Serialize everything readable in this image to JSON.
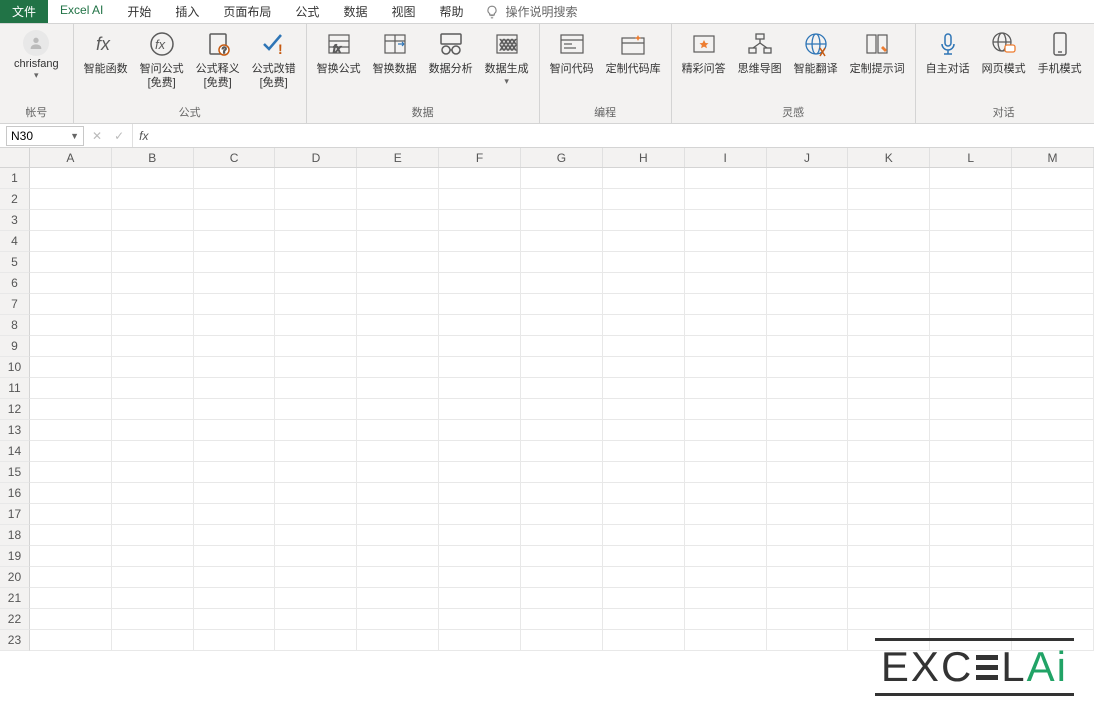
{
  "tabs": {
    "file": "文件",
    "excel_ai": "Excel AI",
    "start": "开始",
    "insert": "插入",
    "layout": "页面布局",
    "formula": "公式",
    "data": "数据",
    "view": "视图",
    "help": "帮助",
    "search_hint": "操作说明搜索"
  },
  "account": {
    "name": "chrisfang",
    "group_label": "帐号"
  },
  "ribbon": {
    "groups": {
      "formula": {
        "label": "公式",
        "items": {
          "smart_func": "智能函数",
          "ask_formula": "智问公式\n[免费]",
          "formula_explain": "公式释义\n[免费]",
          "formula_fix": "公式改错\n[免费]"
        }
      },
      "data": {
        "label": "数据",
        "items": {
          "swap_formula": "智换公式",
          "swap_data": "智换数据",
          "data_analysis": "数据分析",
          "data_gen": "数据生成"
        }
      },
      "programming": {
        "label": "编程",
        "items": {
          "ask_code": "智问代码",
          "code_lib": "定制代码库"
        }
      },
      "inspiration": {
        "label": "灵感",
        "items": {
          "qa": "精彩问答",
          "mindmap": "思维导图",
          "translate": "智能翻译",
          "prompt": "定制提示词"
        }
      },
      "dialog": {
        "label": "对话",
        "items": {
          "auto_dialog": "自主对话",
          "web_mode": "网页模式",
          "mobile_mode": "手机模式"
        }
      }
    }
  },
  "formula_bar": {
    "name_box": "N30",
    "fx_label": "fx"
  },
  "columns": [
    "A",
    "B",
    "C",
    "D",
    "E",
    "F",
    "G",
    "H",
    "I",
    "J",
    "K",
    "L",
    "M"
  ],
  "rows": [
    1,
    2,
    3,
    4,
    5,
    6,
    7,
    8,
    9,
    10,
    11,
    12,
    13,
    14,
    15,
    16,
    17,
    18,
    19,
    20,
    21,
    22,
    23
  ],
  "watermark": {
    "prefix": "EXC",
    "suffix": "L",
    "ai": "Ai"
  }
}
